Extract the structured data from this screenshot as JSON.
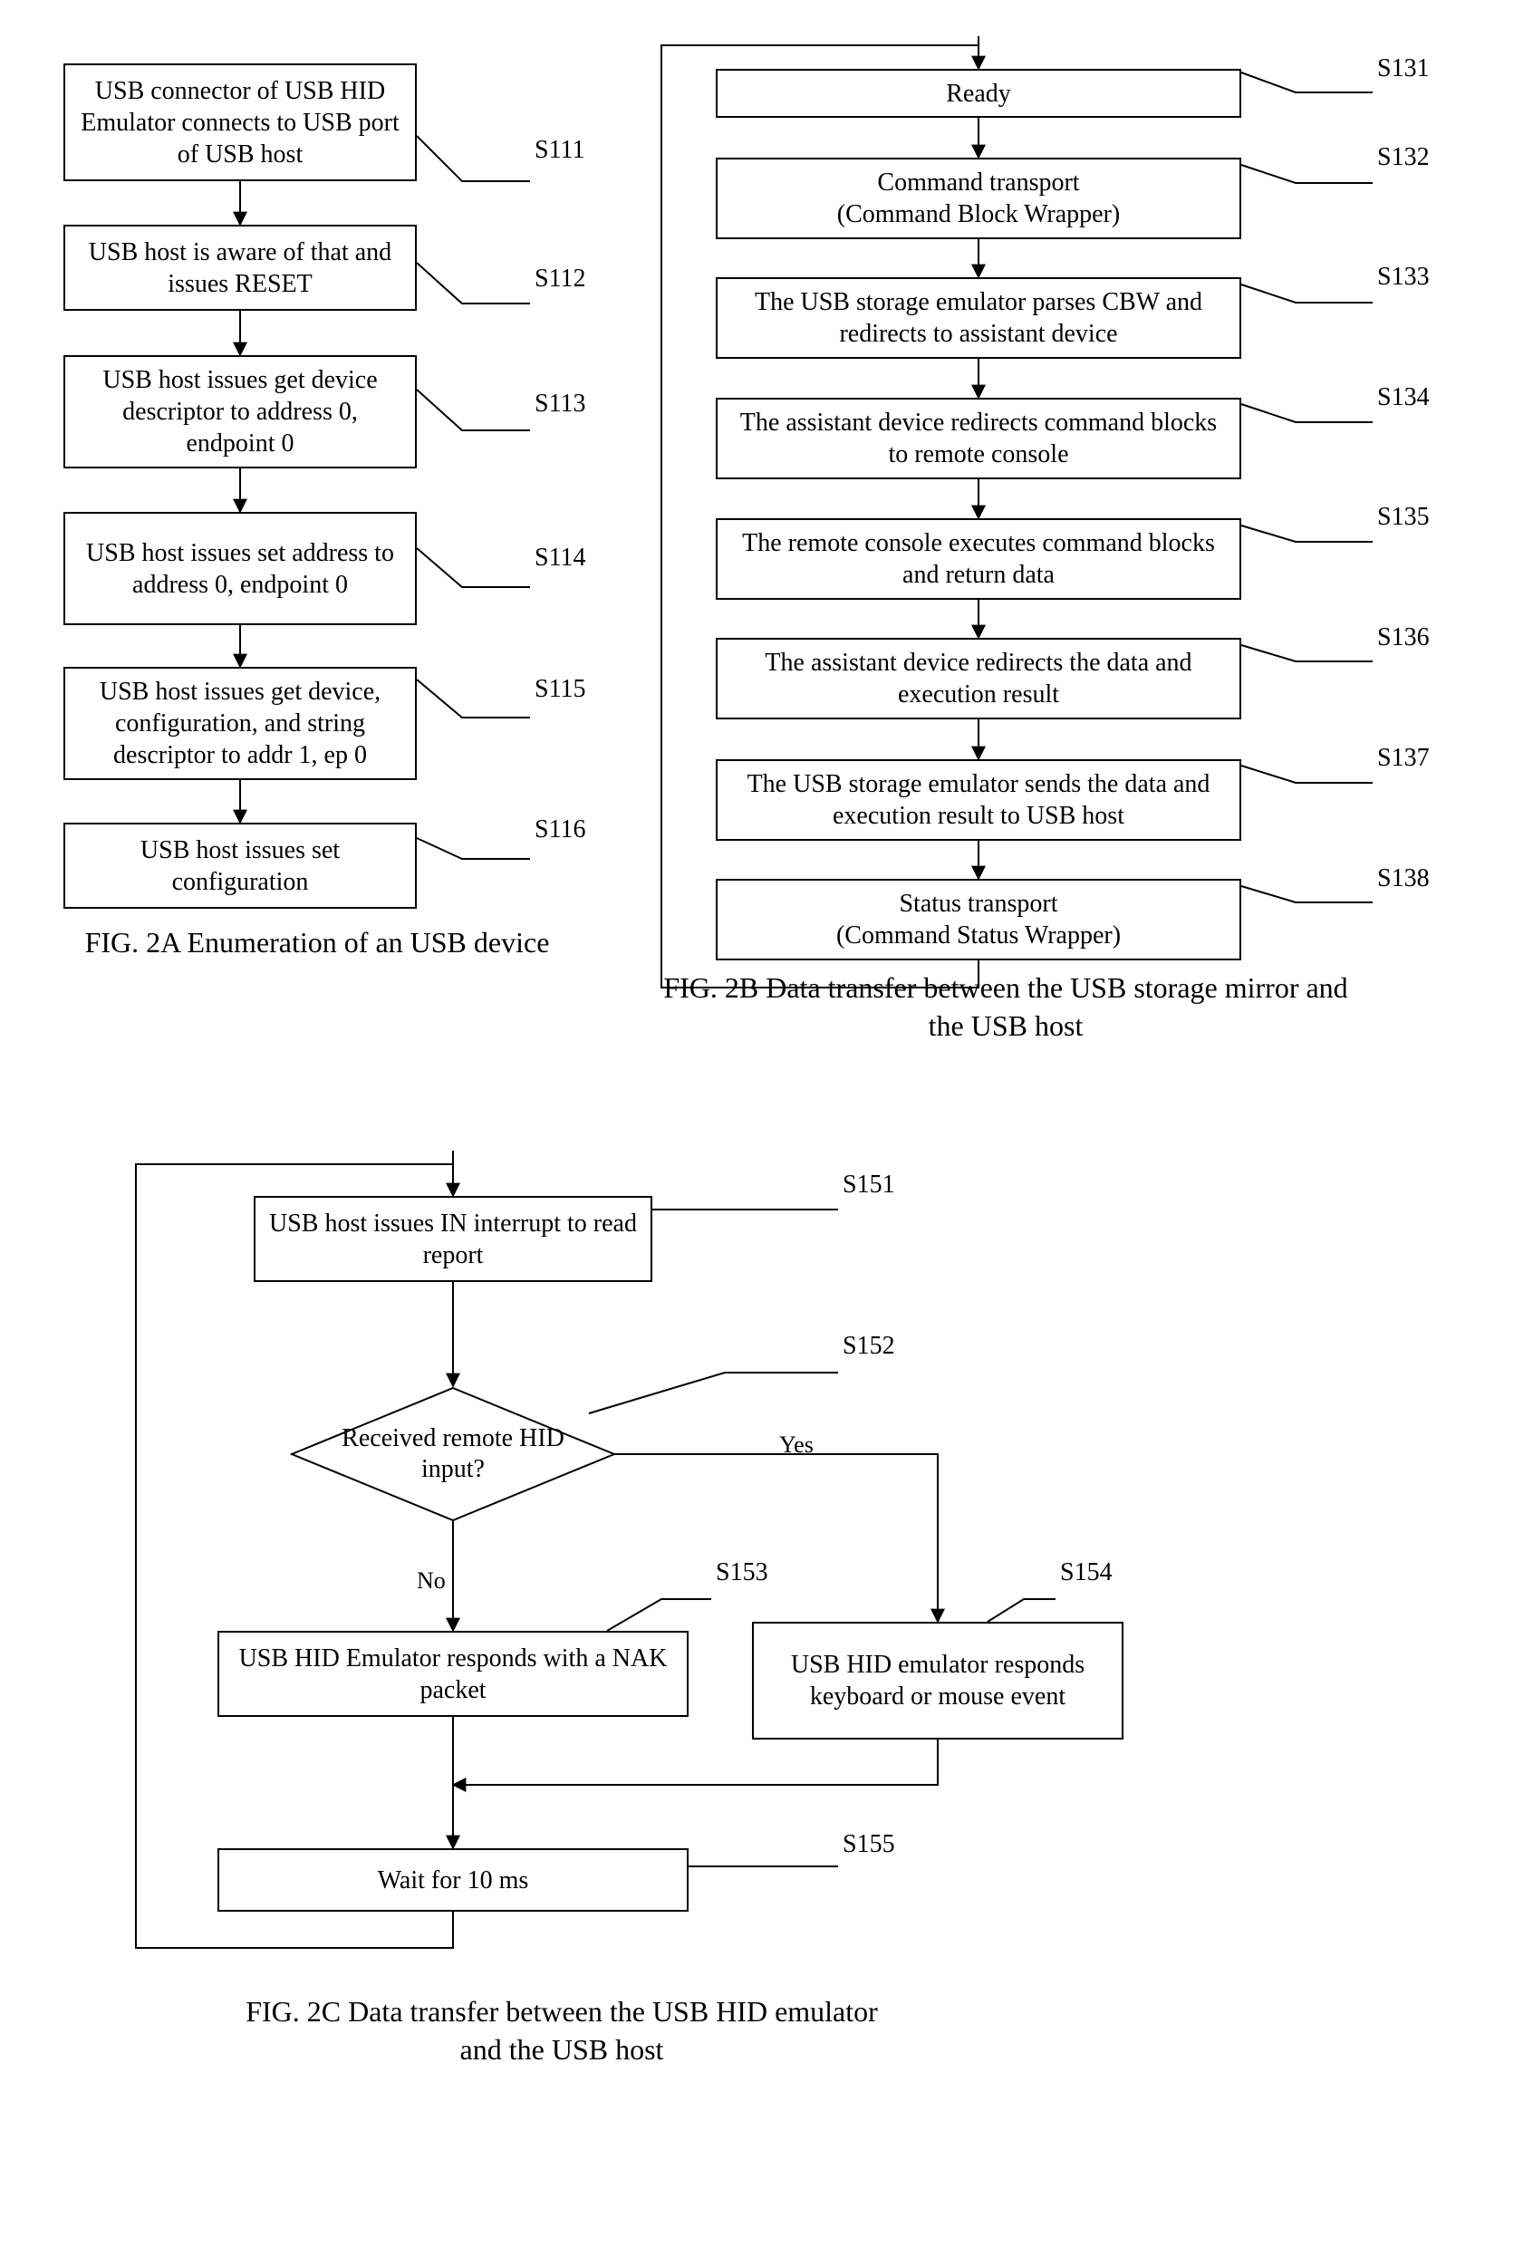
{
  "figA": {
    "steps": [
      {
        "id": "S111",
        "text": "USB connector of USB HID Emulator connects to USB port of USB host"
      },
      {
        "id": "S112",
        "text": "USB host is aware of that and issues RESET"
      },
      {
        "id": "S113",
        "text": "USB host issues get device descriptor to address 0, endpoint 0"
      },
      {
        "id": "S114",
        "text": "USB host issues set address to address 0, endpoint 0"
      },
      {
        "id": "S115",
        "text": "USB host issues get device, configuration, and string descriptor to addr 1, ep 0"
      },
      {
        "id": "S116",
        "text": "USB host issues set configuration"
      }
    ],
    "caption": "FIG. 2A Enumeration of an USB device"
  },
  "figB": {
    "steps": [
      {
        "id": "S131",
        "text": "Ready"
      },
      {
        "id": "S132",
        "text": "Command transport\n(Command Block Wrapper)"
      },
      {
        "id": "S133",
        "text": "The USB storage emulator parses CBW and redirects to assistant device"
      },
      {
        "id": "S134",
        "text": "The assistant device redirects command blocks to remote console"
      },
      {
        "id": "S135",
        "text": "The remote console executes command blocks and return data"
      },
      {
        "id": "S136",
        "text": "The assistant device redirects the data and execution result"
      },
      {
        "id": "S137",
        "text": "The USB storage emulator sends the data and execution result to USB host"
      },
      {
        "id": "S138",
        "text": "Status transport\n(Command Status Wrapper)"
      }
    ],
    "caption": "FIG. 2B Data transfer between the USB storage mirror and the USB host"
  },
  "figC": {
    "s151": {
      "id": "S151",
      "text": "USB host issues IN interrupt to read report"
    },
    "s152": {
      "id": "S152",
      "text": "Received remote HID input?"
    },
    "s153": {
      "id": "S153",
      "text": "USB HID Emulator  responds with a NAK packet"
    },
    "s154": {
      "id": "S154",
      "text": "USB HID emulator responds keyboard or mouse event"
    },
    "s155": {
      "id": "S155",
      "text": "Wait for 10 ms"
    },
    "yes": "Yes",
    "no": "No",
    "caption": "FIG. 2C Data transfer between the USB HID emulator and the USB host"
  }
}
